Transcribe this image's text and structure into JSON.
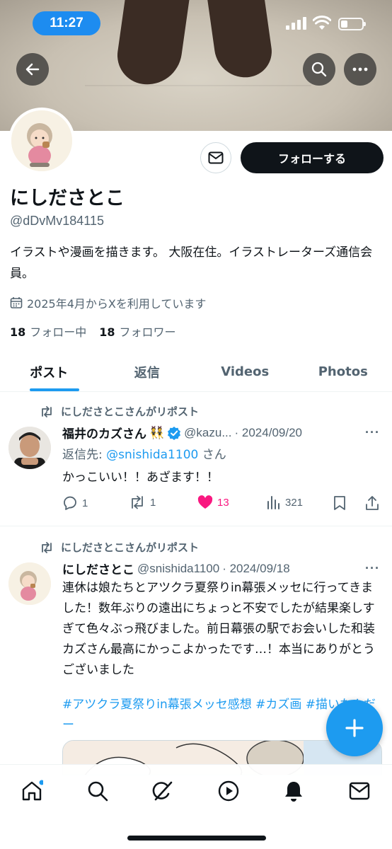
{
  "status_bar": {
    "time": "11:27"
  },
  "profile": {
    "display_name": "にしださとこ",
    "handle": "@dDvMv184115",
    "follow_label": "フォローする",
    "bio": "イラストや漫画を描きます。 大阪在住。イラストレーターズ通信会員。",
    "joined": "2025年4月からXを利用しています",
    "following_count": "18",
    "following_label": "フォロー中",
    "followers_count": "18",
    "followers_label": "フォロワー"
  },
  "tabs": [
    {
      "label": "ポスト",
      "active": true
    },
    {
      "label": "返信",
      "active": false
    },
    {
      "label": "Videos",
      "active": false
    },
    {
      "label": "Photos",
      "active": false
    }
  ],
  "posts": [
    {
      "repost_label": "にしださとこさんがリポスト",
      "author": "福井のカズさん",
      "author_emoji": "👯",
      "handle": "@kazu...",
      "date": "· 2024/09/20",
      "reply_prefix": "返信先: ",
      "reply_mention": "@snishida1100",
      "reply_suffix": " さん",
      "text": "かっこいい！！あざます！！",
      "replies": "1",
      "reposts": "1",
      "likes": "13",
      "views": "321"
    },
    {
      "repost_label": "にしださとこさんがリポスト",
      "author": "にしださとこ",
      "handle": "@snishida1100",
      "date": "· 2024/09/18",
      "text": "連休は娘たちとアツクラ夏祭りin幕張メッセに行ってきました！数年ぶりの遠出にちょっと不安でしたが結果楽しすぎて色々ぶっ飛びました。前日幕張の駅でお会いした和装カズさん最高にかっこよかったです…！本当にありがとうございました",
      "hashtags": "#アツクラ夏祭りin幕張メッセ感想 #カズ画 #描いたんだー"
    }
  ],
  "colors": {
    "accent": "#1d9bf0",
    "like": "#f91880",
    "text": "#0f1419",
    "muted": "#536471"
  },
  "icons": [
    "back-arrow-icon",
    "search-icon",
    "more-icon",
    "mail-icon",
    "calendar-icon",
    "repost-icon",
    "verified-icon",
    "reply-icon",
    "like-icon",
    "views-icon",
    "bookmark-icon",
    "share-icon",
    "plus-icon",
    "home-icon",
    "grok-icon",
    "video-icon",
    "bell-icon",
    "messages-icon"
  ]
}
